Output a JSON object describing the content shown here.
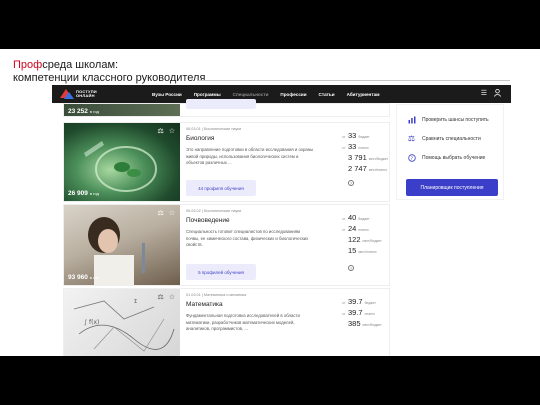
{
  "slide": {
    "title_accent": "Проф",
    "title_rest": "среда школам:",
    "title_line2": "компетенции классного руководителя"
  },
  "navbar": {
    "logo_line1": "ПОСТУПИ",
    "logo_line2": "ОНЛАЙН",
    "links": [
      "Вузы России",
      "Программы",
      "Специальности",
      "Профессии",
      "Статьи",
      "Абитуриентам"
    ]
  },
  "top_strip": {
    "stat_value": "23 252",
    "stat_label": "в год"
  },
  "cards": [
    {
      "meta": "06.03.01  |  Биологические науки",
      "name": "Биология",
      "description": "Это направление подготовки в области исследования и охраны живой природы, использования биологических систем и объектов различных ...",
      "button": "44 профиля обучения",
      "stat_value": "26 909",
      "stat_label": "в год",
      "stats": [
        {
          "pre": "от",
          "value": "33",
          "label": "бюджет"
        },
        {
          "pre": "от",
          "value": "33",
          "label": "платно"
        },
        {
          "pre": "",
          "value": "3 791",
          "label": "мест/бюджет"
        },
        {
          "pre": "",
          "value": "2 747",
          "label": "мест/платно"
        }
      ]
    },
    {
      "meta": "06.03.02  |  Биологические науки",
      "name": "Почвоведение",
      "description": "Специальность готовит специалистов по исследованиям почвы, ее химического состава, физических и биологических свойств.",
      "button": "5 профилей обучения",
      "stat_value": "93 960",
      "stat_label": "в год",
      "stats": [
        {
          "pre": "от",
          "value": "40",
          "label": "бюджет"
        },
        {
          "pre": "от",
          "value": "24",
          "label": "платно"
        },
        {
          "pre": "",
          "value": "122",
          "label": "мест/бюджет"
        },
        {
          "pre": "",
          "value": "15",
          "label": "мест/платно"
        }
      ]
    },
    {
      "meta": "01.03.01  |  Математика и механика",
      "name": "Математика",
      "description": "Фундаментальная подготовка исследователей в области математики, разработчиков математических моделей, аналитиков, программистов, ...",
      "stats": [
        {
          "pre": "от",
          "value": "39.7",
          "label": "бюджет"
        },
        {
          "pre": "от",
          "value": "39.7",
          "label": "платно"
        },
        {
          "pre": "",
          "value": "385",
          "label": "мест/бюджет"
        }
      ]
    }
  ],
  "sidebar": {
    "items": [
      "Проверить шансы поступить",
      "Сравнить специальности",
      "Помощь выбрать обучение"
    ],
    "button": "Планировщик поступления"
  },
  "colors": {
    "accent": "#d0021b",
    "brand": "#3b3ec8",
    "navbar": "#1b1b1b"
  }
}
